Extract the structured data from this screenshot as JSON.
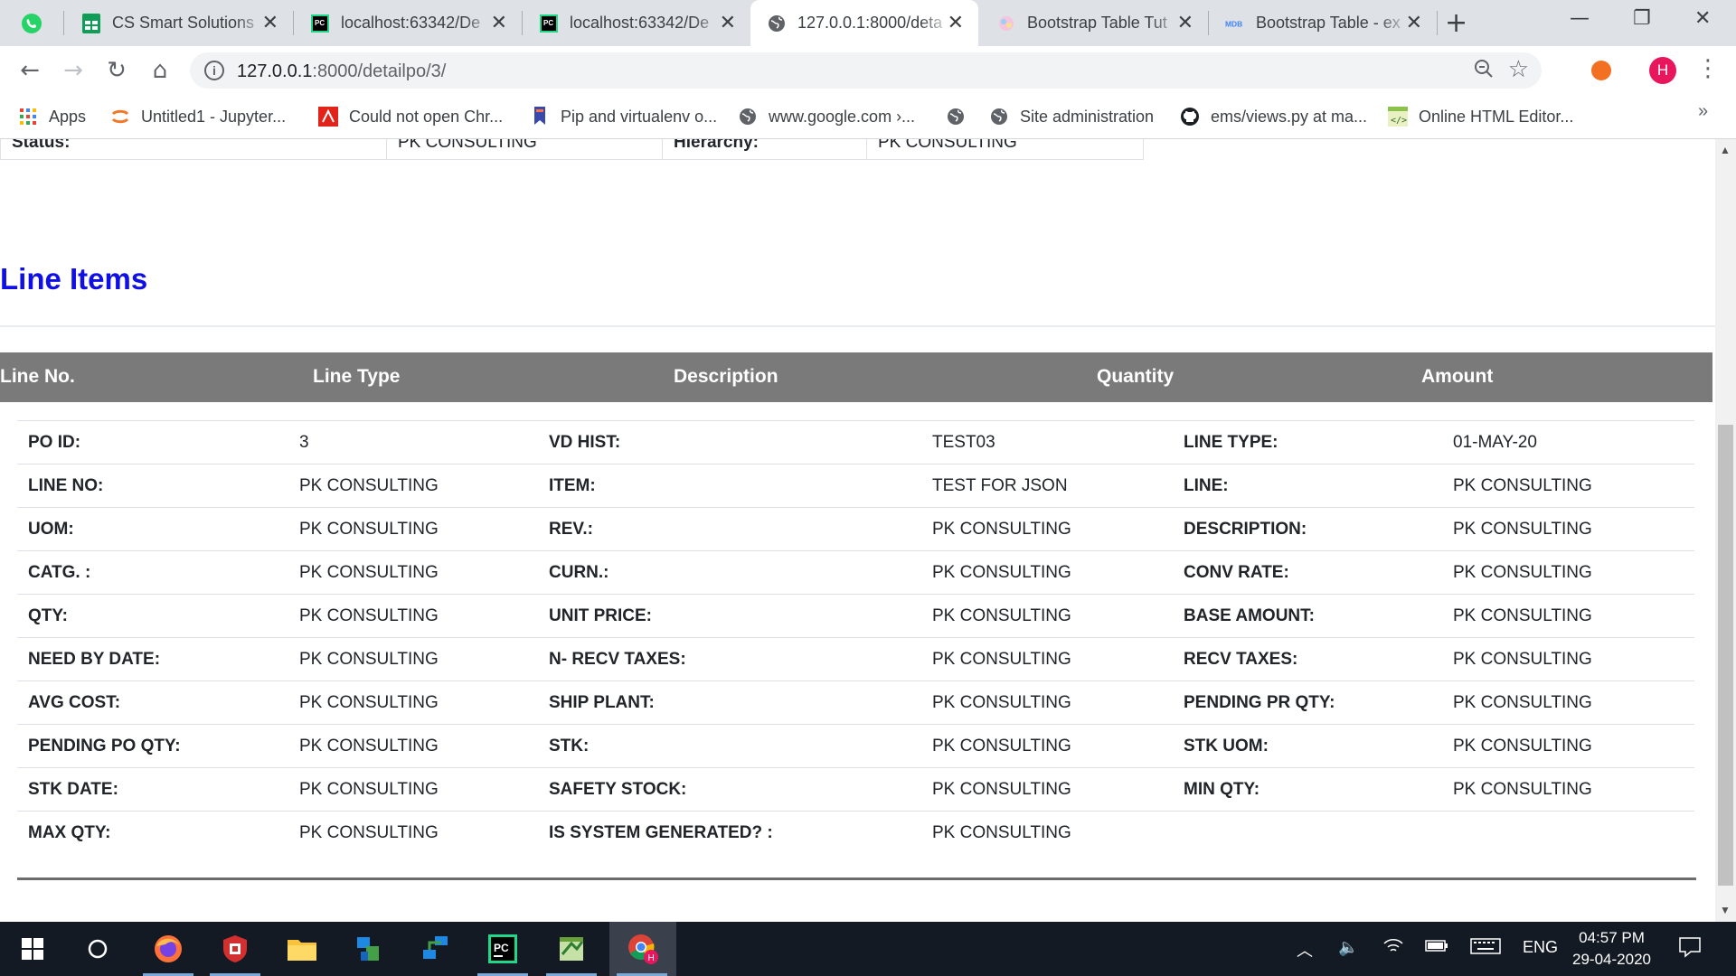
{
  "browser": {
    "tabs": [
      {
        "title": "CS Smart Solutions",
        "icon": "google-sheets-icon"
      },
      {
        "title": "localhost:63342/De",
        "icon": "pycharm-icon"
      },
      {
        "title": "localhost:63342/De",
        "icon": "pycharm-icon"
      },
      {
        "title": "127.0.0.1:8000/deta",
        "icon": "globe-icon",
        "active": true
      },
      {
        "title": "Bootstrap Table Tut",
        "icon": "bootstrap-icon"
      },
      {
        "title": "Bootstrap Table - ex",
        "icon": "mdb-icon"
      }
    ],
    "url": {
      "host": "127.0.0.1",
      "path": ":8000/detailpo/3/"
    },
    "bookmarks": [
      {
        "label": "Apps",
        "icon": "apps-grid-icon"
      },
      {
        "label": "Untitled1 - Jupyter...",
        "icon": "jupyter-icon"
      },
      {
        "label": "Could not open Chr...",
        "icon": "pdf-icon"
      },
      {
        "label": "Pip and virtualenv o...",
        "icon": "bookmark-icon"
      },
      {
        "label": "www.google.com ›...",
        "icon": "globe-icon"
      },
      {
        "label": "",
        "icon": "globe-icon"
      },
      {
        "label": "Site administration",
        "icon": "globe-icon"
      },
      {
        "label": "ems/views.py at ma...",
        "icon": "github-icon"
      },
      {
        "label": "Online HTML Editor...",
        "icon": "code-editor-icon"
      }
    ],
    "avatar_letter": "H"
  },
  "page": {
    "top_row": [
      {
        "text": "Status:",
        "bold": true
      },
      {
        "text": "PK CONSULTING",
        "bold": false
      },
      {
        "text": "Hierarchy:",
        "bold": true
      },
      {
        "text": "PK CONSULTING",
        "bold": false
      }
    ],
    "section_title": "Line Items",
    "table_headers": [
      "Line No.",
      "Line Type",
      "Description",
      "Quantity",
      "Amount"
    ],
    "detail_rows": [
      [
        {
          "l": "PO ID:",
          "v": "3"
        },
        {
          "l": "VD HIST:",
          "v": "TEST03"
        },
        {
          "l": "LINE TYPE:",
          "v": "01-MAY-20"
        }
      ],
      [
        {
          "l": "LINE NO:",
          "v": "PK CONSULTING"
        },
        {
          "l": "ITEM:",
          "v": "TEST FOR JSON"
        },
        {
          "l": "LINE:",
          "v": "PK CONSULTING"
        }
      ],
      [
        {
          "l": "UOM:",
          "v": "PK CONSULTING"
        },
        {
          "l": "REV.:",
          "v": "PK CONSULTING"
        },
        {
          "l": "DESCRIPTION:",
          "v": "PK CONSULTING"
        }
      ],
      [
        {
          "l": "CATG. :",
          "v": "PK CONSULTING"
        },
        {
          "l": "CURN.:",
          "v": "PK CONSULTING"
        },
        {
          "l": "CONV RATE:",
          "v": "PK CONSULTING"
        }
      ],
      [
        {
          "l": "QTY:",
          "v": "PK CONSULTING"
        },
        {
          "l": "UNIT PRICE:",
          "v": "PK CONSULTING"
        },
        {
          "l": "BASE AMOUNT:",
          "v": "PK CONSULTING"
        }
      ],
      [
        {
          "l": "NEED BY DATE:",
          "v": "PK CONSULTING"
        },
        {
          "l": "N- RECV TAXES:",
          "v": "PK CONSULTING"
        },
        {
          "l": "RECV TAXES:",
          "v": "PK CONSULTING"
        }
      ],
      [
        {
          "l": "AVG COST:",
          "v": "PK CONSULTING"
        },
        {
          "l": "SHIP PLANT:",
          "v": "PK CONSULTING"
        },
        {
          "l": "PENDING PR QTY:",
          "v": "PK CONSULTING"
        }
      ],
      [
        {
          "l": "PENDING PO QTY:",
          "v": "PK CONSULTING"
        },
        {
          "l": "STK:",
          "v": "PK CONSULTING"
        },
        {
          "l": "STK UOM:",
          "v": "PK CONSULTING"
        }
      ],
      [
        {
          "l": "STK DATE:",
          "v": "PK CONSULTING"
        },
        {
          "l": "SAFETY STOCK:",
          "v": "PK CONSULTING"
        },
        {
          "l": "MIN QTY:",
          "v": "PK CONSULTING"
        }
      ],
      [
        {
          "l": "MAX QTY:",
          "v": "PK CONSULTING"
        },
        {
          "l": "IS SYSTEM GENERATED? :",
          "v": "PK CONSULTING"
        }
      ]
    ]
  },
  "taskbar": {
    "language": "ENG",
    "time": "04:57 PM",
    "date": "29-04-2020"
  },
  "colors": {
    "section_title": "#1010e6",
    "table_header_bg": "#7a7a7a",
    "avatar": "#e8175d"
  }
}
